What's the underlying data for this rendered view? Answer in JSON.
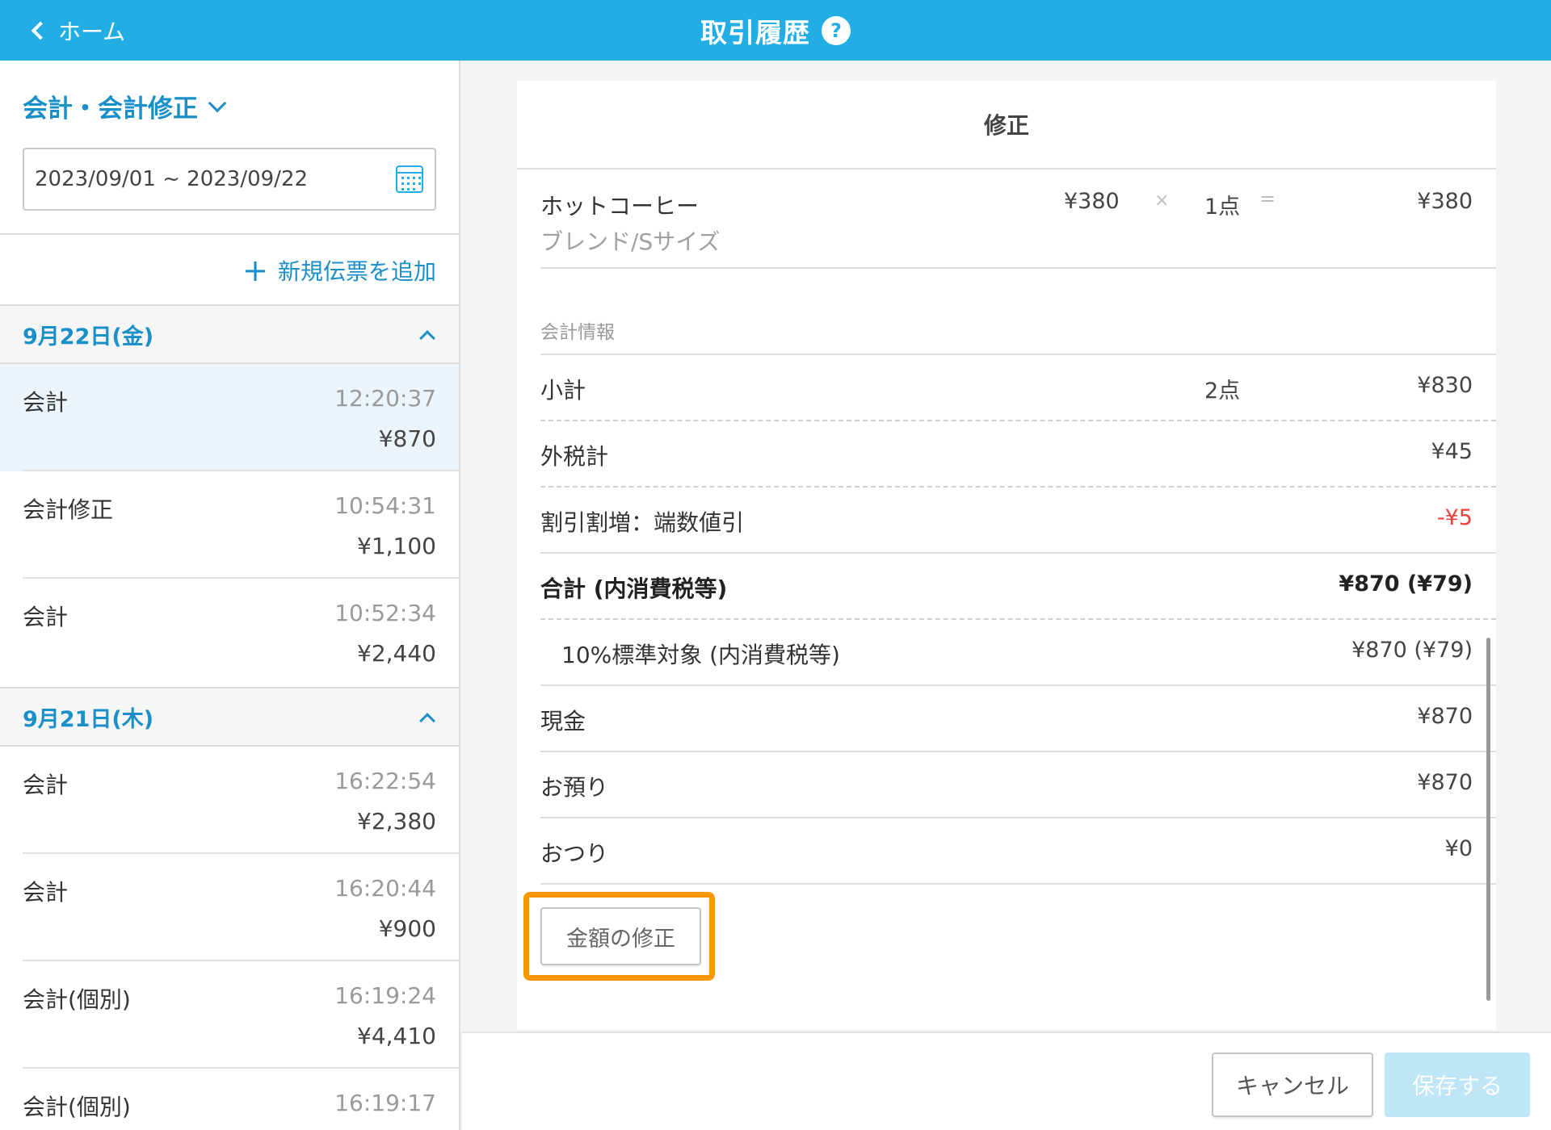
{
  "header": {
    "back_label": "ホーム",
    "title": "取引履歴",
    "help_glyph": "?"
  },
  "sidebar": {
    "filter_label": "会計・会計修正",
    "date_range": "2023/09/01 ~ 2023/09/22",
    "add_new_label": "新規伝票を追加",
    "days": [
      {
        "label": "9月22日(金)",
        "transactions": [
          {
            "kind": "会計",
            "time": "12:20:37",
            "amount": "¥870",
            "selected": true
          },
          {
            "kind": "会計修正",
            "time": "10:54:31",
            "amount": "¥1,100"
          },
          {
            "kind": "会計",
            "time": "10:52:34",
            "amount": "¥2,440"
          }
        ]
      },
      {
        "label": "9月21日(木)",
        "transactions": [
          {
            "kind": "会計",
            "time": "16:22:54",
            "amount": "¥2,380"
          },
          {
            "kind": "会計",
            "time": "16:20:44",
            "amount": "¥900"
          },
          {
            "kind": "会計(個別)",
            "time": "16:19:24",
            "amount": "¥4,410"
          },
          {
            "kind": "会計(個別)",
            "time": "16:19:17",
            "amount": ""
          }
        ]
      }
    ]
  },
  "detail": {
    "title": "修正",
    "item": {
      "name": "ホットコーヒー",
      "variant": "ブレンド/Sサイズ",
      "unit_price": "¥380",
      "times": "×",
      "qty": "1点",
      "eq": "=",
      "total": "¥380"
    },
    "section_label": "会計情報",
    "rows": {
      "subtotal": {
        "label": "小計",
        "qty": "2点",
        "value": "¥830"
      },
      "tax": {
        "label": "外税計",
        "value": "¥45"
      },
      "discount": {
        "label": "割引割増：端数値引",
        "value": "-¥5"
      },
      "total": {
        "label": "合計 (内消費税等)",
        "value": "¥870 (¥79)"
      },
      "standard": {
        "label": "10%標準対象 (内消費税等)",
        "value": "¥870 (¥79)"
      },
      "cash": {
        "label": "現金",
        "value": "¥870"
      },
      "deposit": {
        "label": "お預り",
        "value": "¥870"
      },
      "change": {
        "label": "おつり",
        "value": "¥0"
      }
    },
    "fix_amount_label": "金額の修正"
  },
  "footer": {
    "cancel_label": "キャンセル",
    "save_label": "保存する"
  },
  "colors": {
    "header": "#22aee4",
    "accent": "#1b8fc8",
    "highlight": "#ff9800",
    "negative": "#e8413c",
    "save_disabled": "#bfe6f6"
  }
}
